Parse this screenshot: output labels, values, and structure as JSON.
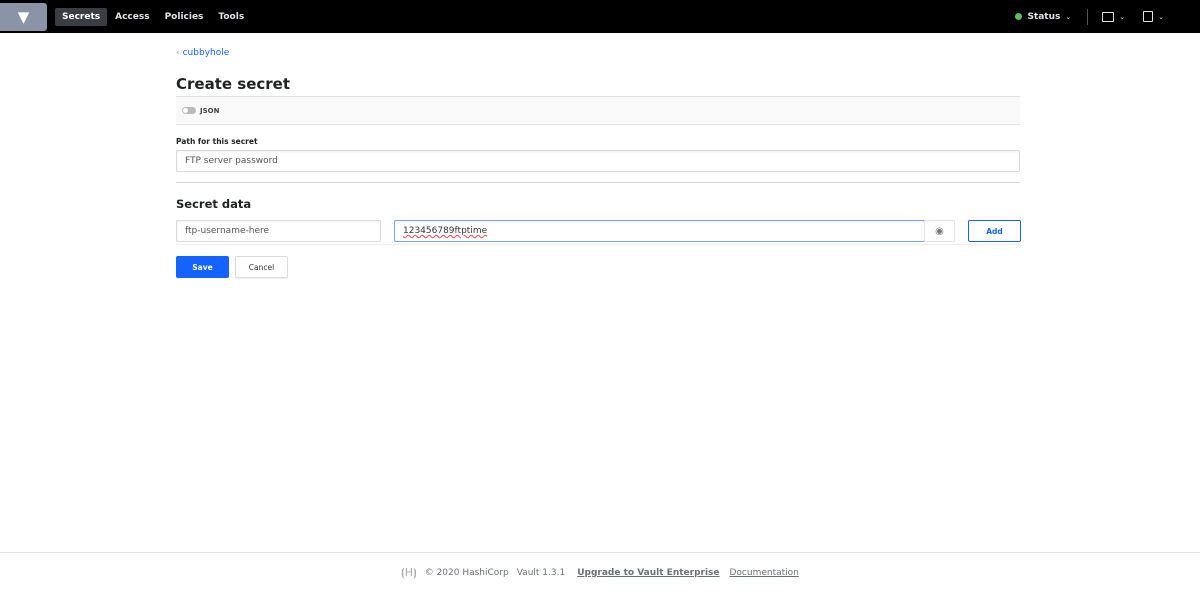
{
  "nav": {
    "items": [
      "Secrets",
      "Access",
      "Policies",
      "Tools"
    ],
    "active": "Secrets",
    "status": "Status",
    "status_color": "#5fbb5f"
  },
  "breadcrumb": "cubbyhole",
  "title": "Create secret",
  "json_toggle": "JSON",
  "path": {
    "label": "Path for this secret",
    "value": "FTP server password"
  },
  "secret_data": {
    "heading": "Secret data",
    "key": "ftp-username-here",
    "value": "123456789ftptime",
    "add_label": "Add"
  },
  "actions": {
    "save": "Save",
    "cancel": "Cancel"
  },
  "footer": {
    "copyright": "© 2020 HashiCorp",
    "version": "Vault 1.3.1",
    "upgrade": "Upgrade to Vault Enterprise",
    "docs": "Documentation"
  },
  "accent": "#1563ff"
}
